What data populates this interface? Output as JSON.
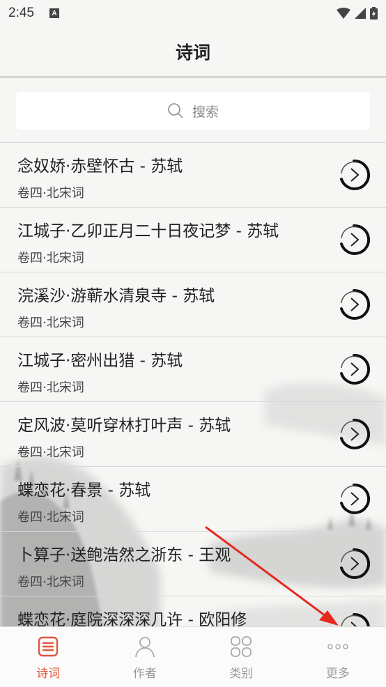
{
  "status_bar": {
    "time": "2:45",
    "notif_letter": "A"
  },
  "header": {
    "title": "诗词"
  },
  "search": {
    "placeholder": "搜索"
  },
  "poems": [
    {
      "title": "念奴娇·赤壁怀古 - 苏轼",
      "source": "卷四·北宋词"
    },
    {
      "title": "江城子·乙卯正月二十日夜记梦 - 苏轼",
      "source": "卷四·北宋词"
    },
    {
      "title": "浣溪沙·游蕲水清泉寺 - 苏轼",
      "source": "卷四·北宋词"
    },
    {
      "title": "江城子·密州出猎 - 苏轼",
      "source": "卷四·北宋词"
    },
    {
      "title": "定风波·莫听穿林打叶声 - 苏轼",
      "source": "卷四·北宋词"
    },
    {
      "title": "蝶恋花·春景 - 苏轼",
      "source": "卷四·北宋词"
    },
    {
      "title": "卜算子·送鲍浩然之浙东 - 王观",
      "source": "卷四·北宋词"
    },
    {
      "title": "蝶恋花·庭院深深深几许 - 欧阳修",
      "source": ""
    }
  ],
  "tabs": [
    {
      "label": "诗词",
      "icon": "document-list-icon",
      "active": true
    },
    {
      "label": "作者",
      "icon": "person-icon",
      "active": false
    },
    {
      "label": "类别",
      "icon": "grid-icon",
      "active": false
    },
    {
      "label": "更多",
      "icon": "more-dots-icon",
      "active": false
    }
  ],
  "colors": {
    "accent": "#e2553f",
    "inactive": "#999999",
    "annotation_arrow": "#e8281e"
  }
}
